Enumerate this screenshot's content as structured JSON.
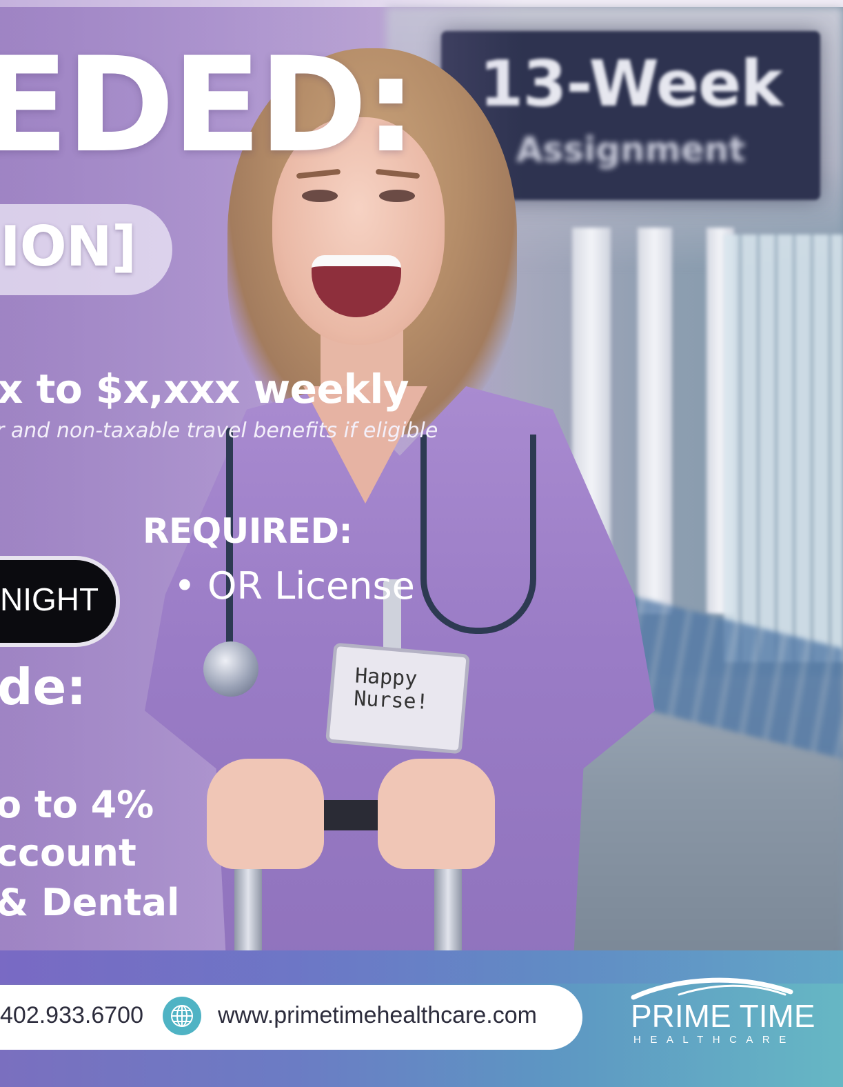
{
  "headline": "EDED:",
  "location": "ION]",
  "pay": {
    "range": "x to $x,xxx weekly",
    "note": "r and non-taxable travel benefits if eligible"
  },
  "requirements": {
    "title": "REQUIRED:",
    "items": [
      "OR License"
    ]
  },
  "shift": "NIGHT",
  "includes_title": "de:",
  "benefits": [
    "o to 4%",
    "ccount",
    "& Dental"
  ],
  "background_sign": {
    "title": "13-Week",
    "subtitle": "Assignment"
  },
  "name_badge": [
    "Happy",
    "Nurse!"
  ],
  "contact": {
    "phone": "402.933.6700",
    "website": "www.primetimehealthcare.com"
  },
  "logo": {
    "name": "PRIME TIME",
    "tagline": "HEALTHCARE"
  },
  "colors": {
    "footer_start": "#7a6fbf",
    "footer_end": "#66b7c4",
    "shift_pill": "#0b0b0f",
    "globe_icon": "#4fb3c4"
  },
  "icons": {
    "website": "globe-icon",
    "logo_mark": "swoosh-icon"
  }
}
